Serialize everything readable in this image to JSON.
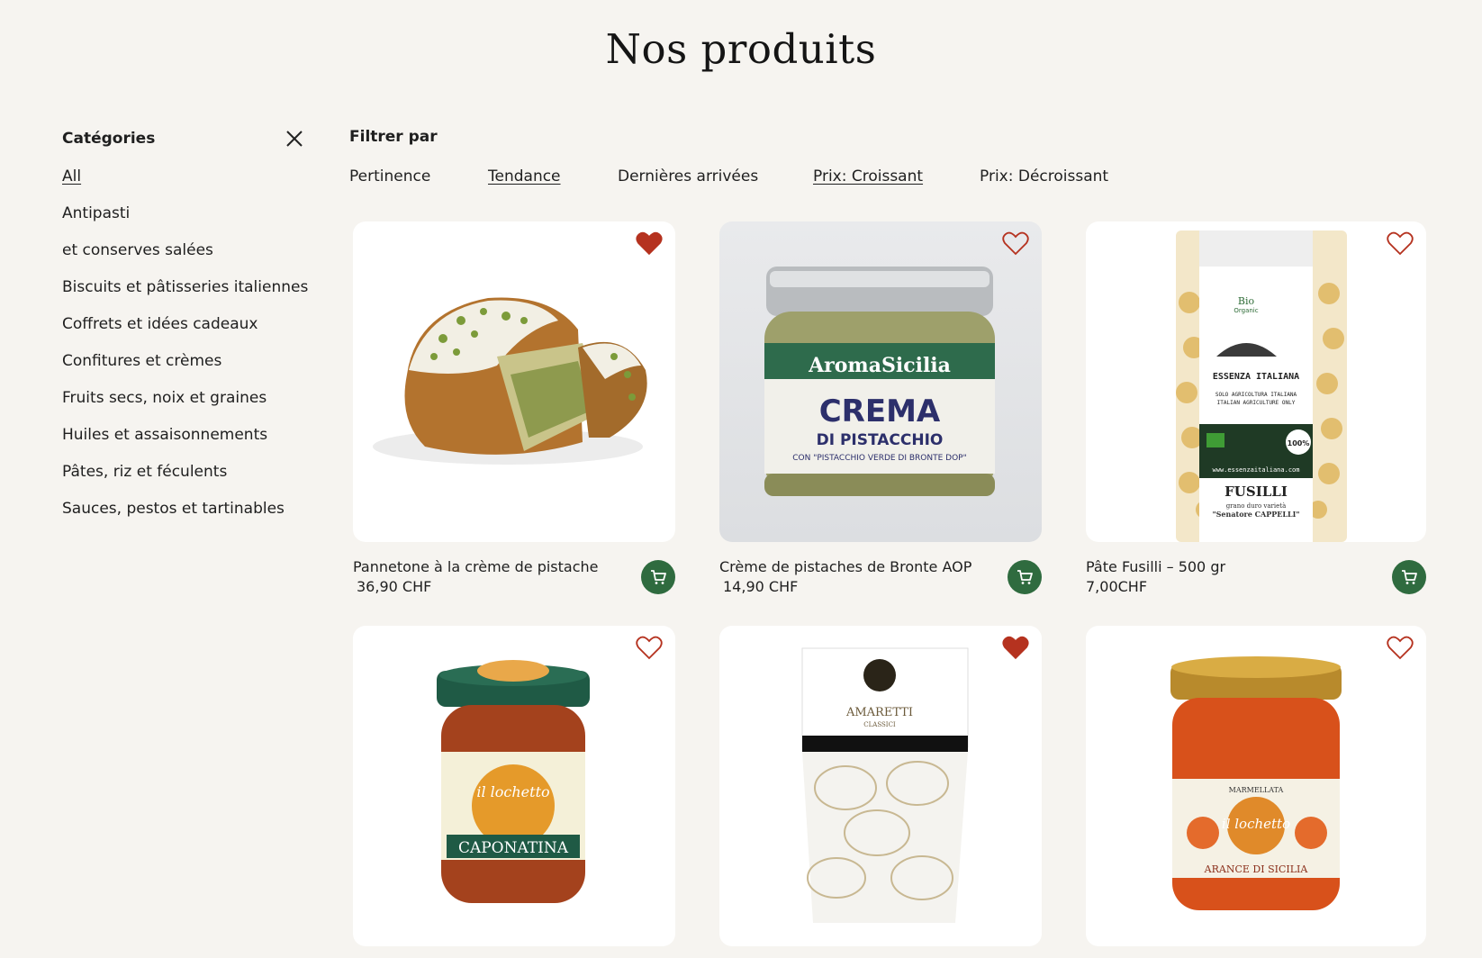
{
  "page": {
    "title": "Nos produits"
  },
  "sidebar": {
    "title": "Catégories",
    "items": [
      {
        "label": "All"
      },
      {
        "label": "Antipasti"
      },
      {
        "label": "et conserves salées"
      },
      {
        "label": "Biscuits et pâtisseries italiennes"
      },
      {
        "label": "Coffrets et idées cadeaux"
      },
      {
        "label": "Confitures et crèmes"
      },
      {
        "label": "Fruits secs, noix et graines"
      },
      {
        "label": "Huiles et assaisonnements"
      },
      {
        "label": "Pâtes, riz et féculents"
      },
      {
        "label": "Sauces, pestos et tartinables"
      }
    ],
    "active_index": 0,
    "close_icon": "close-icon"
  },
  "filters": {
    "title": "Filtrer par",
    "options": [
      {
        "label": "Pertinence"
      },
      {
        "label": "Tendance"
      },
      {
        "label": "Dernières arrivées"
      },
      {
        "label": "Prix: Croissant"
      },
      {
        "label": "Prix: Décroissant"
      }
    ]
  },
  "products": [
    {
      "name": "Pannetone à la crème de pistache",
      "price": "36,90 CHF",
      "favorite": true,
      "image_desc": "pannetone",
      "cart_icon": "cart-icon"
    },
    {
      "name": "Crème de pistaches de Bronte AOP",
      "price": "14,90 CHF",
      "favorite": false,
      "image_desc": "pistachio-jar",
      "cart_icon": "cart-icon"
    },
    {
      "name": "Pâte Fusilli – 500 gr",
      "price": "7,00CHF",
      "favorite": false,
      "image_desc": "fusilli-bag",
      "cart_icon": "cart-icon"
    },
    {
      "name": "",
      "price": "",
      "favorite": false,
      "image_desc": "caponatina-jar"
    },
    {
      "name": "",
      "price": "",
      "favorite": true,
      "image_desc": "amaretti-bag"
    },
    {
      "name": "",
      "price": "",
      "favorite": false,
      "image_desc": "orange-marmalade-jar"
    }
  ],
  "product_labels": {
    "pistachio_brand": "AromaSicilia",
    "pistachio_main": "CREMA",
    "pistachio_sub": "DI PISTACCHIO",
    "pistachio_small": "CON \"PISTACCHIO VERDE DI BRONTE DOP\"",
    "fusilli_brand": "ESSENZA ITALIANA",
    "fusilli_line1": "SOLO AGRICOLTURA ITALIANA",
    "fusilli_line2": "ITALIAN AGRICULTURE ONLY",
    "fusilli_bio": "Bio",
    "fusilli_bio2": "Organic",
    "fusilli_web": "www.essenzaitaliana.com",
    "fusilli_name": "FUSILLI",
    "fusilli_desc": "grano duro varietà",
    "fusilli_desc2": "\"Senatore CAPPELLI\"",
    "fusilli_100": "100%",
    "caponata_brand": "il lochetto",
    "caponata_name": "CAPONATINA",
    "amaretti_name": "AMARETTI",
    "amaretti_sub": "CLASSICI",
    "marmalade_top": "MARMELLATA",
    "marmalade_brand": "il lochetto",
    "marmalade_name": "ARANCE DI SICILIA"
  },
  "colors": {
    "background": "#f6f4f0",
    "cart_green": "#2f6b3f",
    "heart_red": "#b5321f"
  }
}
